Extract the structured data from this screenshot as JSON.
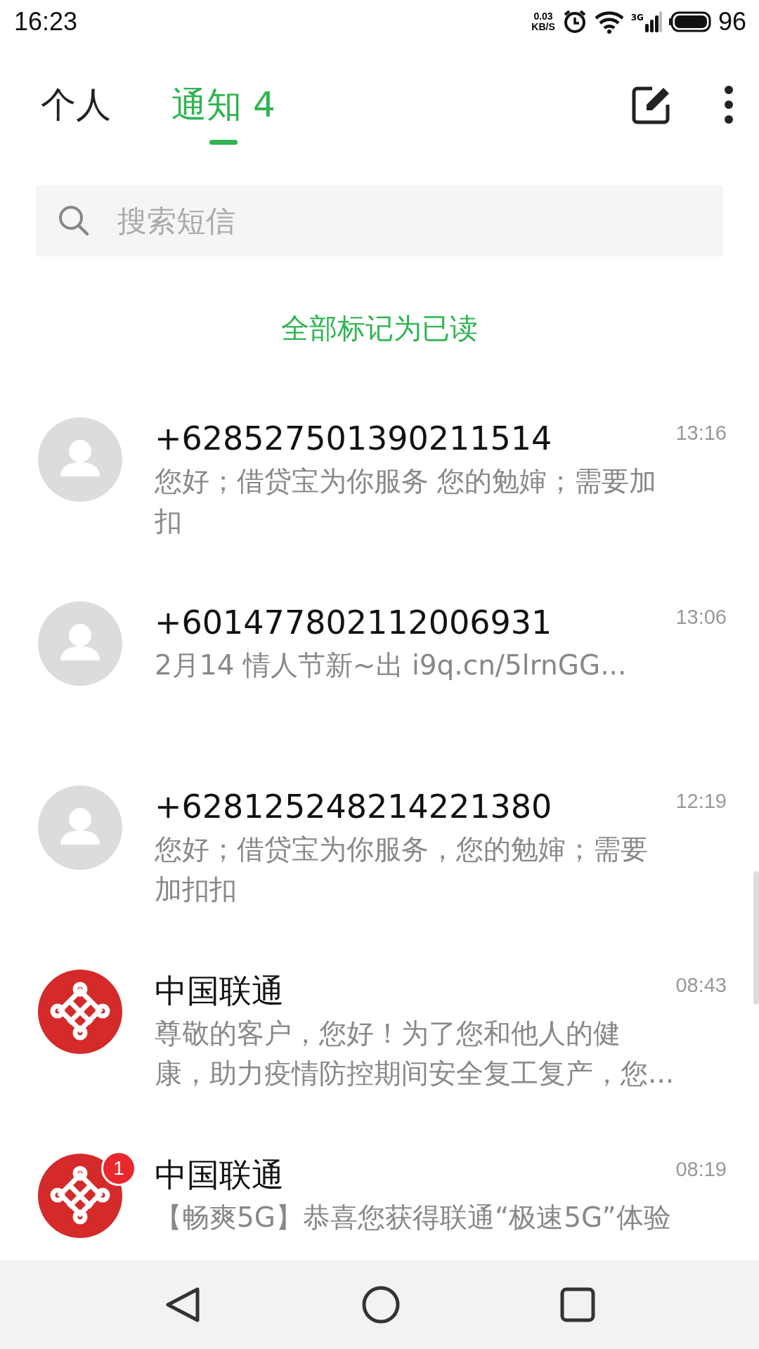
{
  "status_bar": {
    "time": "16:23",
    "speed_value": "0.03",
    "speed_unit": "KB/S",
    "network": "3G",
    "battery": "96"
  },
  "tabs": [
    {
      "label": "个人",
      "selected": false
    },
    {
      "label": "通知 4",
      "selected": true
    }
  ],
  "search": {
    "placeholder": "搜索短信"
  },
  "mark_all_read": "全部标记为已读",
  "messages": [
    {
      "kind": "contact",
      "sender": "+628527501390211514",
      "time": "13:16",
      "preview": "您好；借贷宝为你服务 您的勉婶；需要加扣"
    },
    {
      "kind": "contact",
      "sender": "+601477802112006931",
      "time": "13:06",
      "preview": "2月14 情人节新~出 i9q.cn/5lrnGG..."
    },
    {
      "kind": "contact",
      "sender": "+628125248214221380",
      "time": "12:19",
      "preview": "您好；借贷宝为你服务，您的勉婶；需要加扣扣"
    },
    {
      "kind": "operator",
      "sender": "中国联通",
      "time": "08:43",
      "preview": "尊敬的客户，您好！为了您和他人的健康，助力疫情防控期间安全复工复产，您..."
    },
    {
      "kind": "operator",
      "sender": "中国联通",
      "time": "08:19",
      "preview": "【畅爽5G】恭喜您获得联通“极速5G”体验",
      "badge": "1"
    }
  ]
}
